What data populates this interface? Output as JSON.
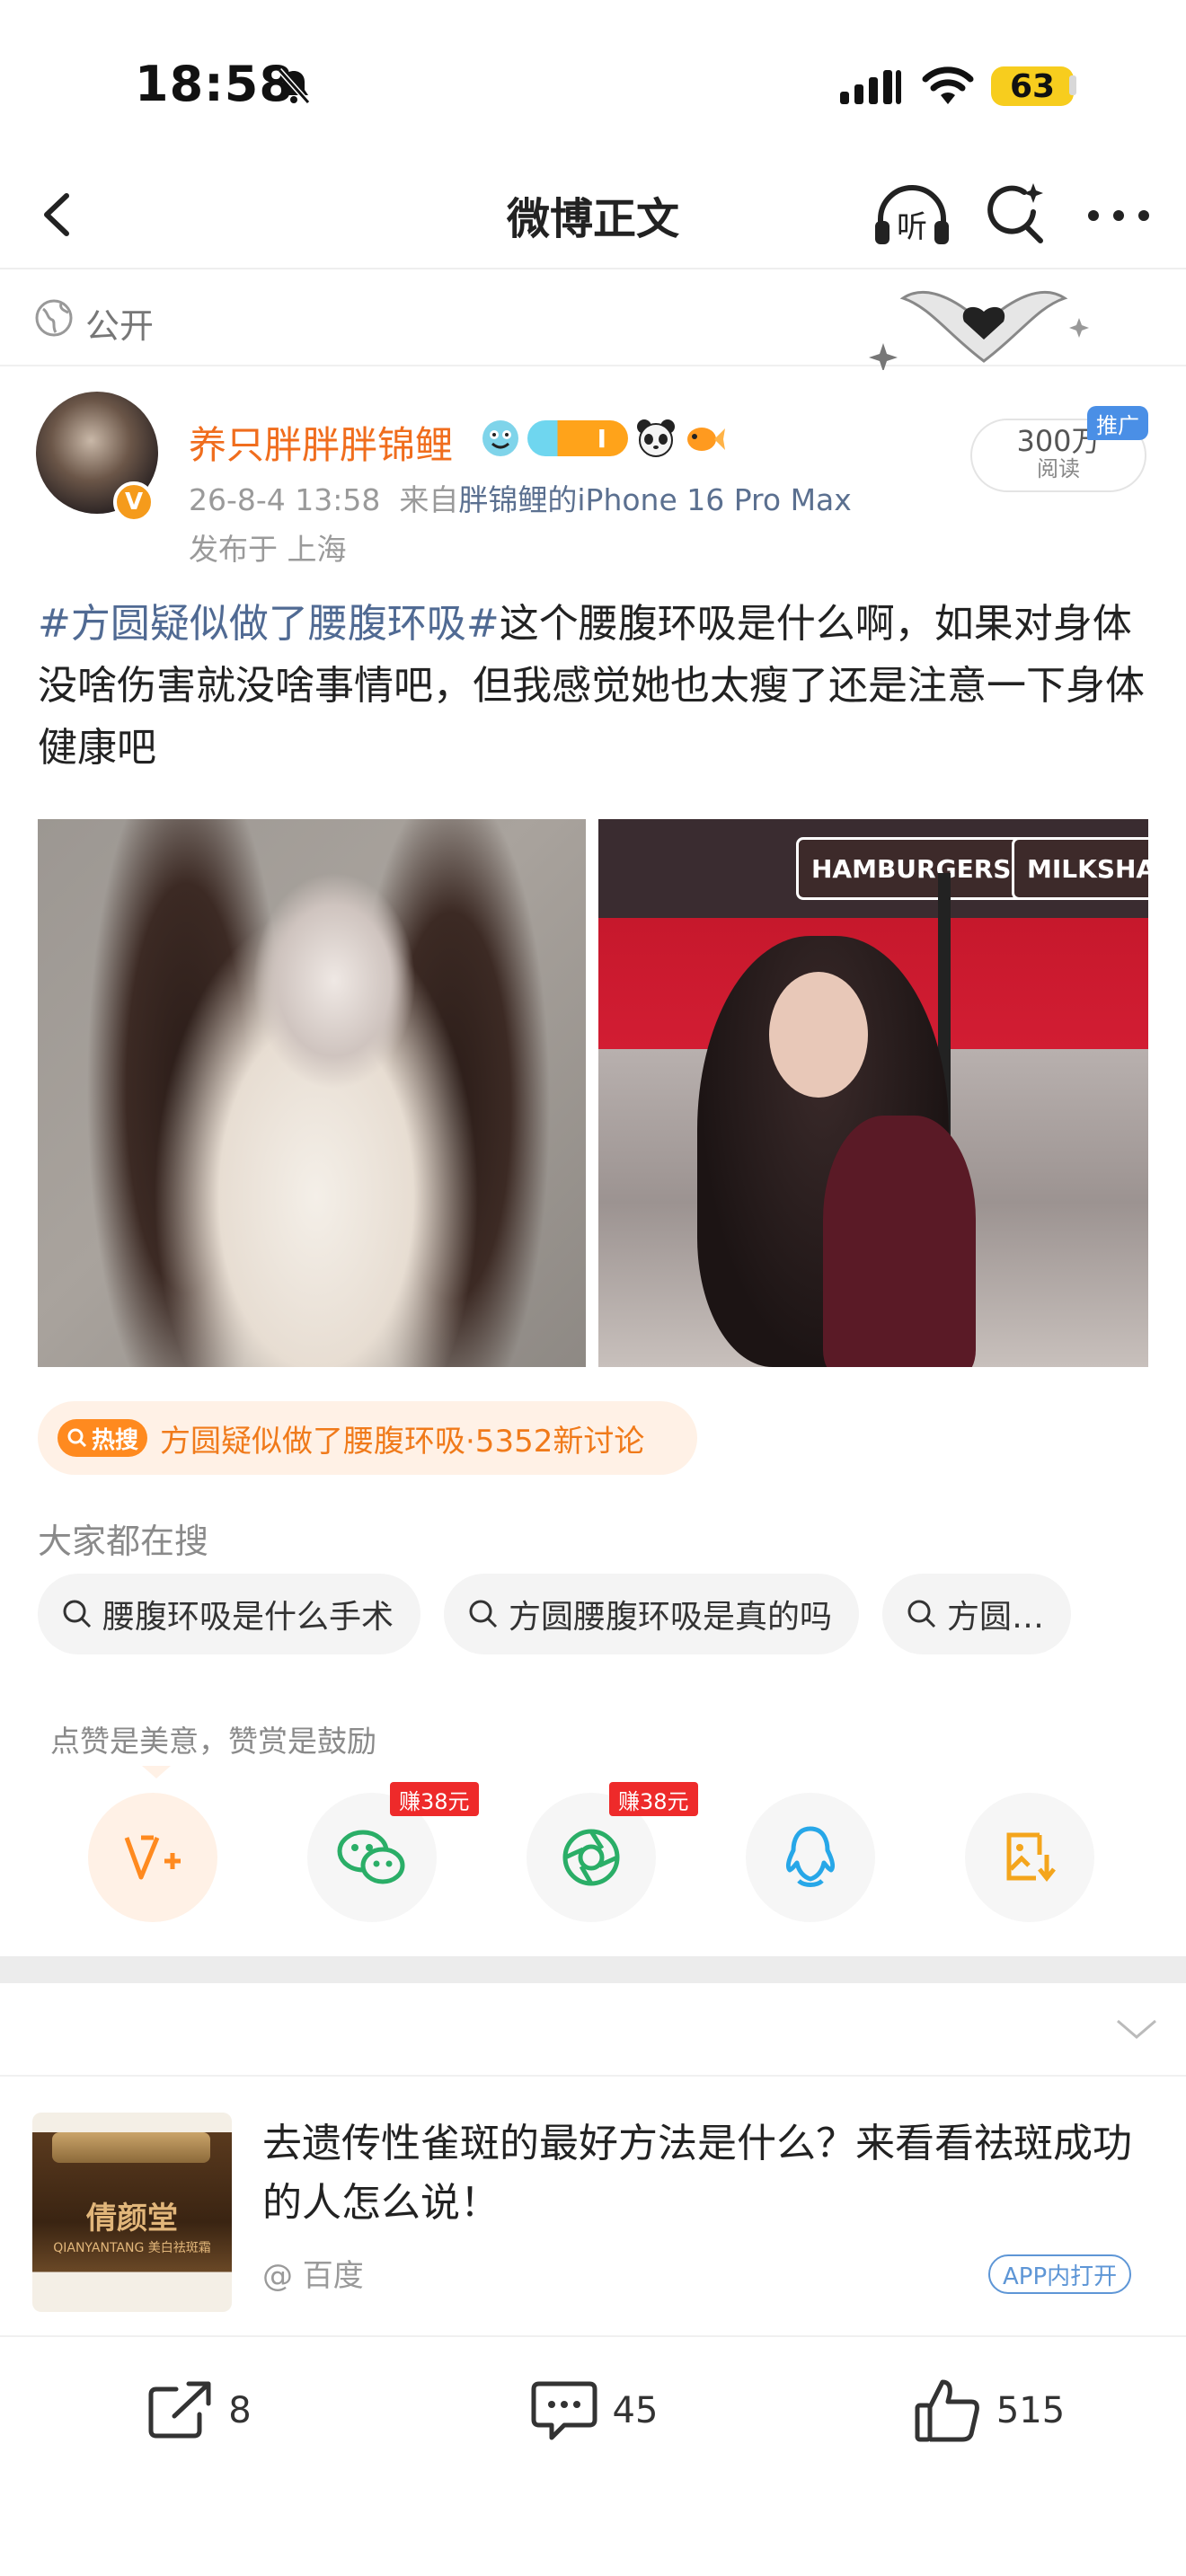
{
  "status_bar": {
    "time": "18:58",
    "battery": "63"
  },
  "nav": {
    "title": "微博正文",
    "listen_label": "听"
  },
  "visibility": {
    "label": "公开"
  },
  "author": {
    "name": "养只胖胖胖锦鲤",
    "verified_badge": "V",
    "level_label": "I",
    "timestamp": "26-8-4 13:58",
    "source_prefix": "来自",
    "source": "胖锦鲤的iPhone 16 Pro Max",
    "location": "发布于 上海"
  },
  "reads": {
    "count": "300万",
    "label": "阅读",
    "ad_label": "推广"
  },
  "post": {
    "hashtag": "#方圆疑似做了腰腹环吸#",
    "text": "这个腰腹环吸是什么啊，如果对身体没啥伤害就没啥事情吧，但我感觉她也太瘦了还是注意一下身体健康吧"
  },
  "images": {
    "signs": [
      "HAMBURGERS",
      "MILKSHA"
    ]
  },
  "hot_search": {
    "icon_label": "热搜",
    "topic": "方圆疑似做了腰腹环吸",
    "suffix": "·5352新讨论"
  },
  "related_searches": {
    "heading": "大家都在搜",
    "items": [
      "腰腹环吸是什么手术",
      "方圆腰腹环吸是真的吗",
      "方圆…"
    ]
  },
  "reward": {
    "label": "点赞是美意，赞赏是鼓励"
  },
  "share_targets": [
    {
      "icon": "reward-v-icon",
      "badge": ""
    },
    {
      "icon": "wechat-icon",
      "badge": "赚38元"
    },
    {
      "icon": "moments-icon",
      "badge": "赚38元"
    },
    {
      "icon": "qq-icon",
      "badge": ""
    },
    {
      "icon": "save-image-icon",
      "badge": ""
    }
  ],
  "ad": {
    "title": "去遗传性雀斑的最好方法是什么？来看看祛斑成功的人怎么说！",
    "source": "@ 百度",
    "open_label": "APP内打开",
    "product_brand": "倩颜堂",
    "product_sub": "QIANYANTANG 美白祛斑霜"
  },
  "actions": {
    "repost_count": "8",
    "comment_count": "45",
    "like_count": "515"
  },
  "colors": {
    "accent_orange": "#f06d1d",
    "link_blue": "#506a93",
    "hot_orange": "#ff8a1f",
    "earn_red": "#ee2a2a"
  }
}
